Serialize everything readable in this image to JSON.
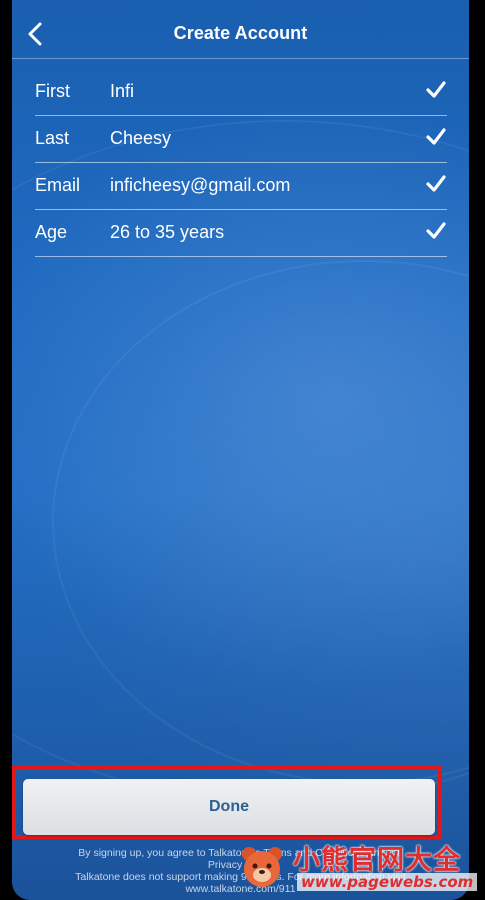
{
  "header": {
    "title": "Create Account"
  },
  "form": {
    "rows": [
      {
        "label": "First",
        "value": "Infi"
      },
      {
        "label": "Last",
        "value": "Cheesy"
      },
      {
        "label": "Email",
        "value": "inficheesy@gmail.com"
      },
      {
        "label": "Age",
        "value": "26 to 35 years"
      }
    ]
  },
  "actions": {
    "done_label": "Done"
  },
  "footer": {
    "line1": "By signing up, you agree to Talkatone's Terms and Conditions and the",
    "line2": "Privacy Policy",
    "line3": "Talkatone does not support making 911 calls. For more information visit",
    "line4": "www.talkatone.com/911"
  },
  "watermark": {
    "chinese": "小熊官网大全",
    "url": "www.pagewebs.com"
  },
  "colors": {
    "background": "#1f6ac0",
    "button_text": "#2e6191",
    "highlight_border": "#e1171a",
    "watermark": "#e02d2d"
  },
  "icons": {
    "back": "chevron-left-icon",
    "valid": "checkmark-icon"
  }
}
